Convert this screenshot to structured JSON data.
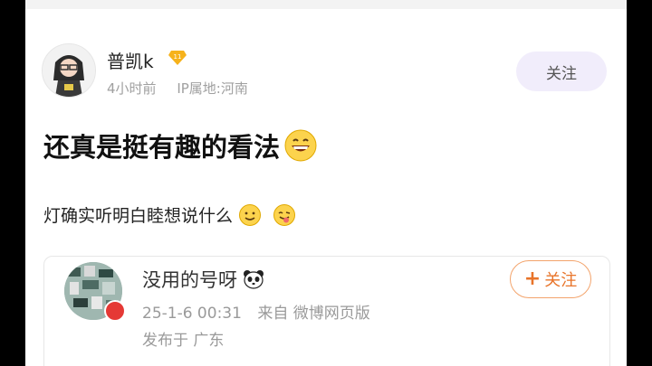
{
  "post": {
    "author": "普凯k",
    "time": "4小时前",
    "ip_location": "IP属地:河南",
    "follow_label": "关注",
    "headline": "还真是挺有趣的看法",
    "body": "灯确实听明白睦想说什么",
    "vip_level": "11"
  },
  "quoted": {
    "name": "没用的号呀",
    "datetime": "25-1-6 00:31",
    "source": "来自 微博网页版",
    "location": "发布于 广东",
    "follow_label": "关注",
    "follow_plus": "+"
  },
  "colors": {
    "follow_bg": "#f1edfb",
    "follow_outline": "#f3a46c",
    "follow_text": "#e8742a",
    "vip_badge": "#f6b21b"
  }
}
